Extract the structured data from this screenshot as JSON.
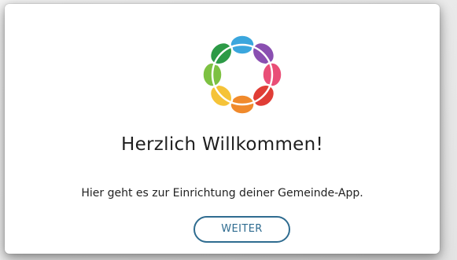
{
  "welcome": {
    "logo_icon": "flower-logo-icon",
    "title": "Herzlich Willkommen!",
    "subtitle": "Hier geht es zur Einrichtung deiner Gemeinde-App.",
    "button_label": "WEITER"
  },
  "colors": {
    "logo_petals": [
      "#3aa6dd",
      "#8a4fb1",
      "#e94e77",
      "#e03d36",
      "#f08a2c",
      "#f5c338",
      "#7dc142",
      "#2c9a46"
    ],
    "button_accent": "#2f6c90",
    "background": "#e9e9e9",
    "card": "#ffffff"
  }
}
